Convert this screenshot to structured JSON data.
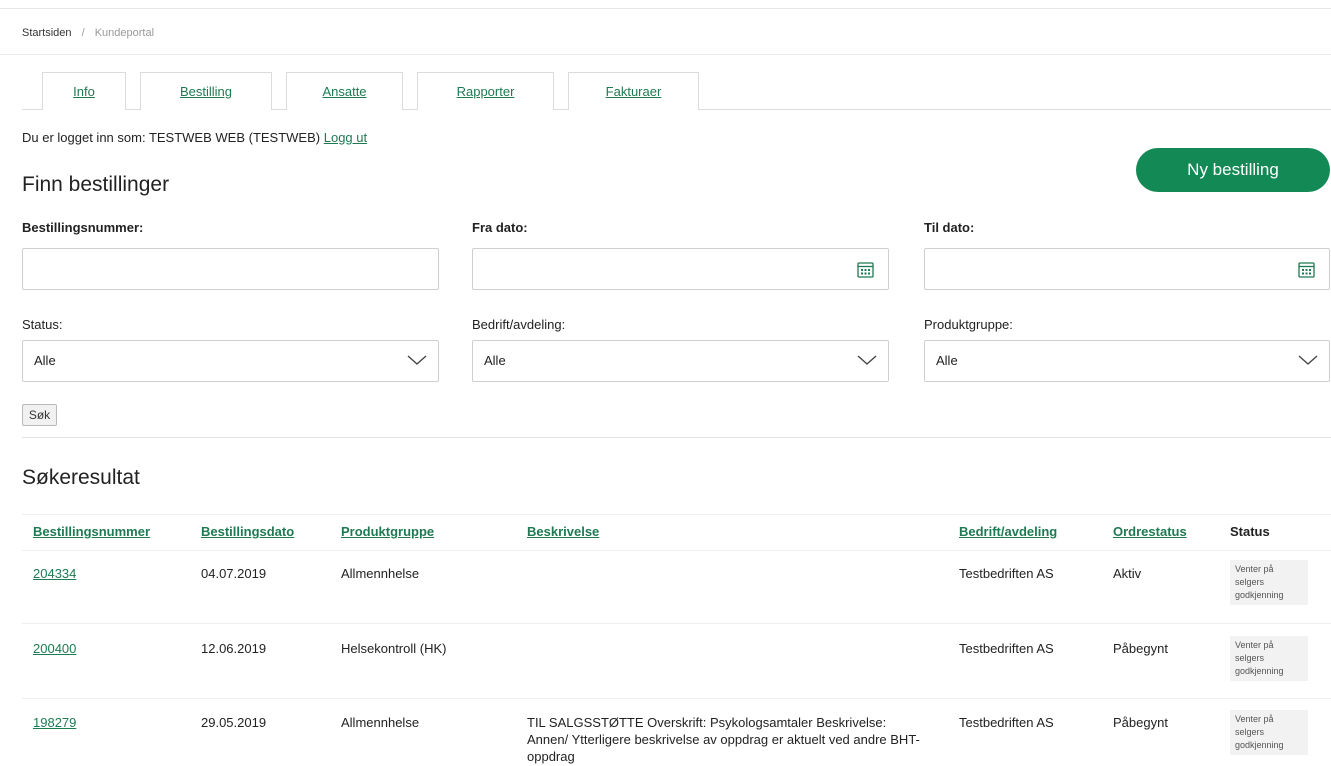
{
  "breadcrumb": {
    "home": "Startsiden",
    "separator": "/",
    "current": "Kundeportal"
  },
  "tabs": [
    {
      "label": "Info"
    },
    {
      "label": "Bestilling"
    },
    {
      "label": "Ansatte"
    },
    {
      "label": "Rapporter"
    },
    {
      "label": "Fakturaer"
    }
  ],
  "login": {
    "text": "Du er logget inn som: TESTWEB WEB (TESTWEB)",
    "logout": "Logg ut"
  },
  "search": {
    "title": "Finn bestillinger",
    "new_order_button": "Ny bestilling",
    "order_number_label": "Bestillingsnummer:",
    "order_number_value": "",
    "from_date_label": "Fra dato:",
    "from_date_value": "",
    "to_date_label": "Til dato:",
    "to_date_value": "",
    "status_label": "Status:",
    "status_value": "Alle",
    "company_label": "Bedrift/avdeling:",
    "company_value": "Alle",
    "product_group_label": "Produktgruppe:",
    "product_group_value": "Alle",
    "search_button": "Søk"
  },
  "results": {
    "title": "Søkeresultat",
    "columns": {
      "order_number": "Bestillingsnummer",
      "order_date": "Bestillingsdato",
      "product_group": "Produktgruppe",
      "description": "Beskrivelse",
      "company": "Bedrift/avdeling",
      "order_status": "Ordrestatus",
      "status": "Status"
    },
    "rows": [
      {
        "order_number": "204334",
        "order_date": "04.07.2019",
        "product_group": "Allmennhelse",
        "description": "",
        "company": "Testbedriften AS",
        "order_status": "Aktiv",
        "status": "Venter på selgers godkjenning"
      },
      {
        "order_number": "200400",
        "order_date": "12.06.2019",
        "product_group": "Helsekontroll (HK)",
        "description": "",
        "company": "Testbedriften AS",
        "order_status": "Påbegynt",
        "status": "Venter på selgers godkjenning"
      },
      {
        "order_number": "198279",
        "order_date": "29.05.2019",
        "product_group": "Allmennhelse",
        "description": "TIL SALGSSTØTTE Overskrift: Psykologsamtaler Beskrivelse: Annen/ Ytterligere beskrivelse av oppdrag er aktuelt ved andre BHT-oppdrag",
        "company": "Testbedriften AS",
        "order_status": "Påbegynt",
        "status": "Venter på selgers godkjenning"
      }
    ]
  },
  "colors": {
    "accent_green": "#138a55",
    "link_green": "#1e7a52"
  },
  "icons": {
    "calendar": "calendar-icon",
    "dropdown": "chevron-down-icon"
  }
}
